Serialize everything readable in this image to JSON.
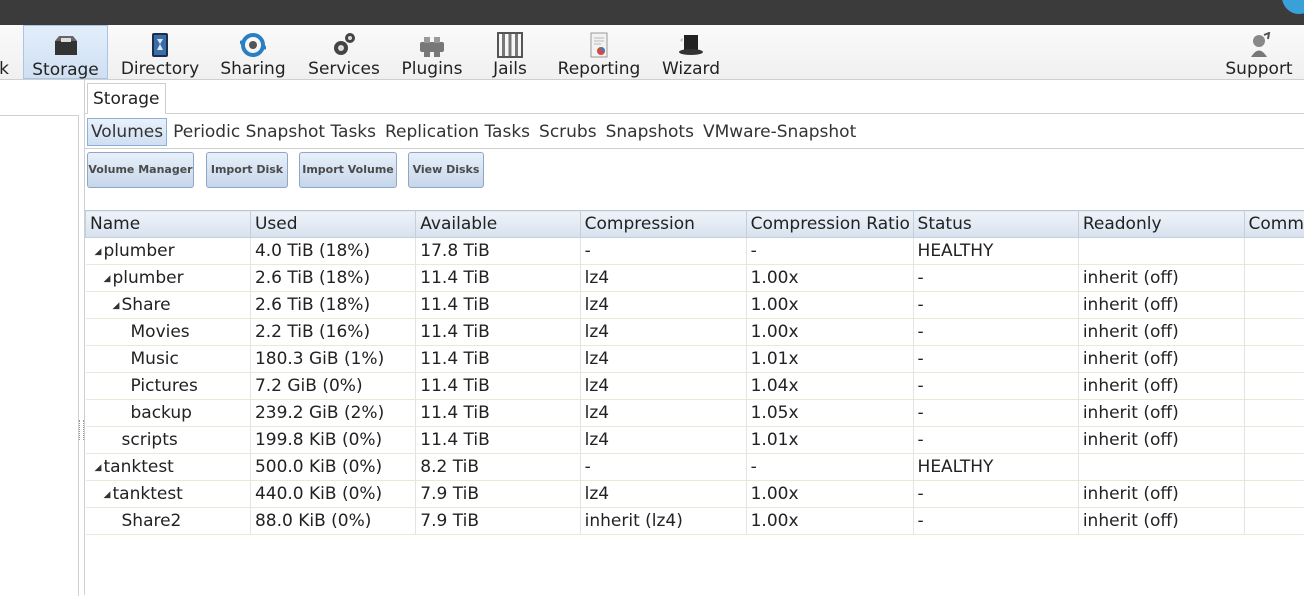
{
  "nav": {
    "items": [
      {
        "key": "network",
        "label": "k",
        "active": false,
        "icon": "network-icon"
      },
      {
        "key": "storage",
        "label": "Storage",
        "active": true,
        "icon": "storage-icon"
      },
      {
        "key": "directory",
        "label": "Directory",
        "active": false,
        "icon": "directory-icon"
      },
      {
        "key": "sharing",
        "label": "Sharing",
        "active": false,
        "icon": "sharing-icon"
      },
      {
        "key": "services",
        "label": "Services",
        "active": false,
        "icon": "gears-icon"
      },
      {
        "key": "plugins",
        "label": "Plugins",
        "active": false,
        "icon": "plugins-icon"
      },
      {
        "key": "jails",
        "label": "Jails",
        "active": false,
        "icon": "jails-icon"
      },
      {
        "key": "reporting",
        "label": "Reporting",
        "active": false,
        "icon": "reporting-icon"
      },
      {
        "key": "wizard",
        "label": "Wizard",
        "active": false,
        "icon": "wizard-hat-icon"
      },
      {
        "key": "support",
        "label": "Support",
        "active": false,
        "icon": "support-icon"
      }
    ]
  },
  "main": {
    "outer_tab": "Storage",
    "subtabs": [
      {
        "label": "Volumes",
        "active": true
      },
      {
        "label": "Periodic Snapshot Tasks",
        "active": false
      },
      {
        "label": "Replication Tasks",
        "active": false
      },
      {
        "label": "Scrubs",
        "active": false
      },
      {
        "label": "Snapshots",
        "active": false
      },
      {
        "label": "VMware-Snapshot",
        "active": false
      }
    ],
    "buttons": [
      "Volume Manager",
      "Import Disk",
      "Import Volume",
      "View Disks"
    ]
  },
  "table": {
    "columns": [
      "Name",
      "Used",
      "Available",
      "Compression",
      "Compression Ratio",
      "Status",
      "Readonly",
      "Comm"
    ],
    "rows": [
      {
        "indent": 0,
        "expander": true,
        "name": "plumber",
        "used": "4.0 TiB (18%)",
        "available": "17.8 TiB",
        "compression": "-",
        "ratio": "-",
        "status": "HEALTHY",
        "readonly": "",
        "comments": ""
      },
      {
        "indent": 1,
        "expander": true,
        "name": "plumber",
        "used": "2.6 TiB (18%)",
        "available": "11.4 TiB",
        "compression": "lz4",
        "ratio": "1.00x",
        "status": "-",
        "readonly": "inherit (off)",
        "comments": ""
      },
      {
        "indent": 2,
        "expander": true,
        "name": "Share",
        "used": "2.6 TiB (18%)",
        "available": "11.4 TiB",
        "compression": "lz4",
        "ratio": "1.00x",
        "status": "-",
        "readonly": "inherit (off)",
        "comments": ""
      },
      {
        "indent": 3,
        "expander": false,
        "name": "Movies",
        "used": "2.2 TiB (16%)",
        "available": "11.4 TiB",
        "compression": "lz4",
        "ratio": "1.00x",
        "status": "-",
        "readonly": "inherit (off)",
        "comments": ""
      },
      {
        "indent": 3,
        "expander": false,
        "name": "Music",
        "used": "180.3 GiB (1%)",
        "available": "11.4 TiB",
        "compression": "lz4",
        "ratio": "1.01x",
        "status": "-",
        "readonly": "inherit (off)",
        "comments": ""
      },
      {
        "indent": 3,
        "expander": false,
        "name": "Pictures",
        "used": "7.2 GiB (0%)",
        "available": "11.4 TiB",
        "compression": "lz4",
        "ratio": "1.04x",
        "status": "-",
        "readonly": "inherit (off)",
        "comments": ""
      },
      {
        "indent": 3,
        "expander": false,
        "name": "backup",
        "used": "239.2 GiB (2%)",
        "available": "11.4 TiB",
        "compression": "lz4",
        "ratio": "1.05x",
        "status": "-",
        "readonly": "inherit (off)",
        "comments": ""
      },
      {
        "indent": 2,
        "expander": false,
        "name": "scripts",
        "used": "199.8 KiB (0%)",
        "available": "11.4 TiB",
        "compression": "lz4",
        "ratio": "1.01x",
        "status": "-",
        "readonly": "inherit (off)",
        "comments": ""
      },
      {
        "indent": 0,
        "expander": true,
        "name": "tanktest",
        "used": "500.0 KiB (0%)",
        "available": "8.2 TiB",
        "compression": "-",
        "ratio": "-",
        "status": "HEALTHY",
        "readonly": "",
        "comments": ""
      },
      {
        "indent": 1,
        "expander": true,
        "name": "tanktest",
        "used": "440.0 KiB (0%)",
        "available": "7.9 TiB",
        "compression": "lz4",
        "ratio": "1.00x",
        "status": "-",
        "readonly": "inherit (off)",
        "comments": ""
      },
      {
        "indent": 2,
        "expander": false,
        "name": "Share2",
        "used": "88.0 KiB (0%)",
        "available": "7.9 TiB",
        "compression": "inherit (lz4)",
        "ratio": "1.00x",
        "status": "-",
        "readonly": "inherit (off)",
        "comments": ""
      }
    ]
  }
}
